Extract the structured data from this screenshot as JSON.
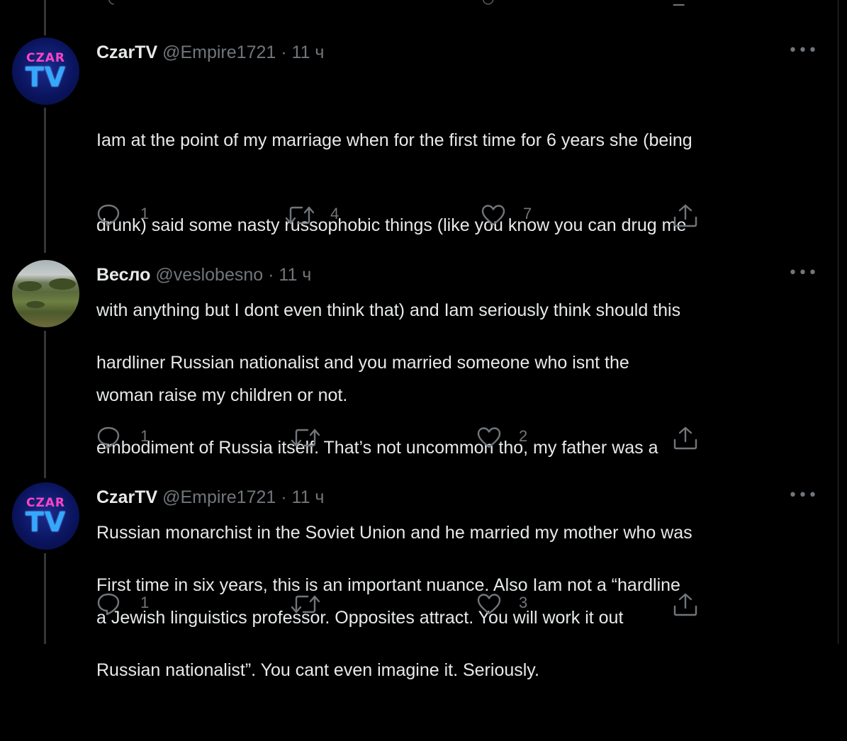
{
  "tweets": [
    {
      "author_name": "CzarTV",
      "handle": "@Empire1721",
      "separator": "·",
      "time": "11 ч",
      "avatar_text_top": "CZAR",
      "avatar_text_bottom": "TV",
      "text_lines": [
        "Iam at the point of my marriage when for the first time for 6 years she (being",
        "drunk) said some nasty russophobic things (like you know you can drug me",
        "with anything but I dont even think that) and Iam seriously think should this",
        "woman raise my children or not."
      ],
      "reply_count": "1",
      "retweet_count": "4",
      "like_count": "7"
    },
    {
      "author_name": "Весло",
      "handle": "@veslobesno",
      "separator": "·",
      "time": "11 ч",
      "text_lines": [
        "hardliner Russian nationalist and you married someone who isnt the",
        "embodiment of Russia itself. That’s not uncommon tho, my father was a",
        "Russian monarchist in the Soviet Union and he married my mother who was",
        "a Jewish linguistics professor. Opposites attract. You will work it out"
      ],
      "reply_count": "1",
      "retweet_count": "",
      "like_count": "2"
    },
    {
      "author_name": "CzarTV",
      "handle": "@Empire1721",
      "separator": "·",
      "time": "11 ч",
      "avatar_text_top": "CZAR",
      "avatar_text_bottom": "TV",
      "text_lines": [
        "First time in six years, this is an important nuance. Also Iam not a “hardline",
        "Russian nationalist”. You cant even imagine it. Seriously."
      ],
      "reply_count": "1",
      "retweet_count": "",
      "like_count": "3"
    }
  ],
  "icons": {
    "reply": "reply-icon",
    "retweet": "retweet-icon",
    "like": "like-icon",
    "share": "share-icon",
    "more": "more-icon"
  },
  "colors": {
    "background": "#000000",
    "text": "#e7e9ea",
    "muted": "#71767b",
    "thread_line": "#333639"
  }
}
